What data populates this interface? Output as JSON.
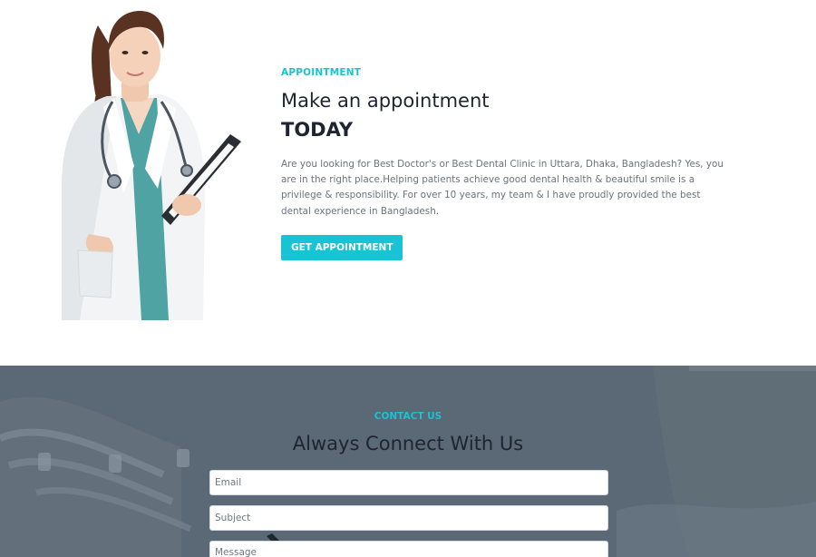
{
  "appointment": {
    "eyebrow": "APPOINTMENT",
    "heading": "Make an appointment",
    "heading_strong": "TODAY",
    "description": "Are you looking for Best Doctor's or Best Dental Clinic in Uttara, Dhaka, Bangladesh? Yes, you are in the right place.Helping patients achieve good dental health & beautiful smile is a privilege & responsibility. For over 10 years, my team & I have proudly provided the best dental experience in Bangladesh.",
    "cta_label": "GET APPOINTMENT"
  },
  "contact": {
    "eyebrow": "CONTACT US",
    "heading": "Always Connect With Us",
    "email_placeholder": "Email",
    "subject_placeholder": "Subject",
    "message_placeholder": "Message"
  },
  "colors": {
    "accent": "#17c3d4",
    "heading": "#1e2530",
    "body_text": "#6b7380",
    "contact_background": "#566472"
  },
  "icons": {
    "doctor_image": "doctor-photo-illustration",
    "contact_background": "dental-equipment-photo-illustration"
  }
}
